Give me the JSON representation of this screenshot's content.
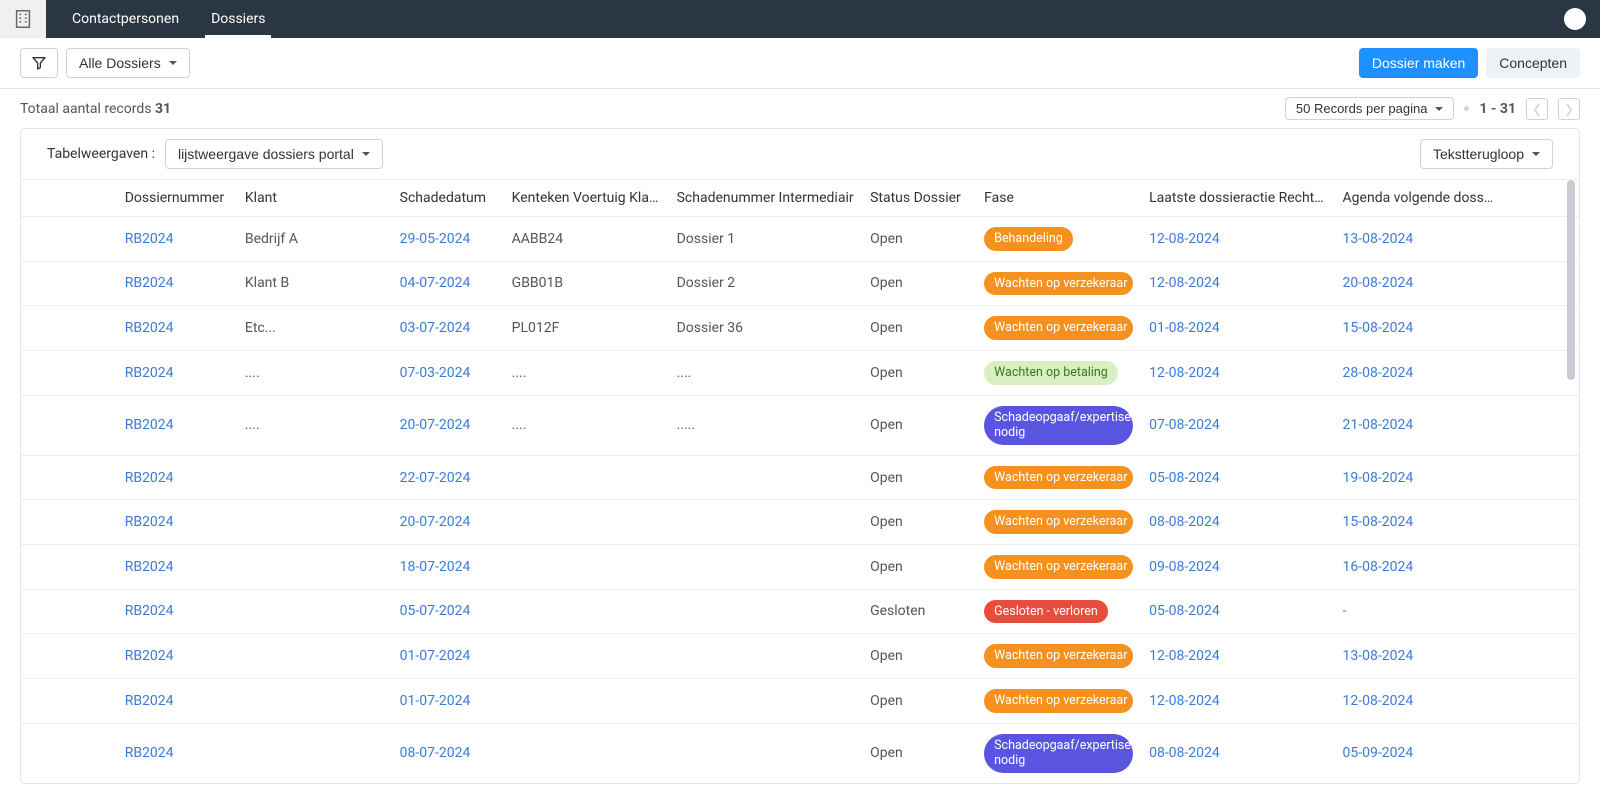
{
  "nav": {
    "items": [
      {
        "label": "Contactpersonen",
        "active": false
      },
      {
        "label": "Dossiers",
        "active": true
      }
    ]
  },
  "toolbar": {
    "view_label": "Alle Dossiers",
    "create_label": "Dossier maken",
    "drafts_label": "Concepten"
  },
  "records": {
    "total_label_prefix": "Totaal aantal records",
    "total_count": "31",
    "per_page_label": "50 Records per pagina",
    "range": "1 - 31"
  },
  "table_toolbar": {
    "label": "Tabelweergaven :",
    "view": "lijstweergave dossiers portal",
    "wrap_label": "Tekstterugloop"
  },
  "columns": [
    "Dossiernummer",
    "Klant",
    "Schadedatum",
    "Kenteken Voertuig Klant",
    "Schadenummer Intermediair",
    "Status Dossier",
    "Fase",
    "Laatste dossieractie RechtBij",
    "Agenda volgende doss…"
  ],
  "phase_colors": {
    "Behandeling": "orange",
    "Wachten op verzekeraar": "orange",
    "Wachten op betaling": "green",
    "Schadeopgaaf/expertiserapport nodig": "purple",
    "Gesloten - verloren": "red"
  },
  "rows": [
    {
      "dossier": "RB2024",
      "klant": "Bedrijf A",
      "schadedatum": "29-05-2024",
      "kenteken": "AABB24",
      "schadenummer": "Dossier 1",
      "status": "Open",
      "fase": "Behandeling",
      "laatste": "12-08-2024",
      "agenda": "13-08-2024"
    },
    {
      "dossier": "RB2024",
      "klant": "Klant B",
      "schadedatum": "04-07-2024",
      "kenteken": "GBB01B",
      "schadenummer": "Dossier 2",
      "status": "Open",
      "fase": "Wachten op verzekeraar",
      "laatste": "12-08-2024",
      "agenda": "20-08-2024"
    },
    {
      "dossier": "RB2024",
      "klant": "Etc...",
      "schadedatum": "03-07-2024",
      "kenteken": "PL012F",
      "schadenummer": "Dossier 36",
      "status": "Open",
      "fase": "Wachten op verzekeraar",
      "laatste": "01-08-2024",
      "agenda": "15-08-2024"
    },
    {
      "dossier": "RB2024",
      "klant": "....",
      "schadedatum": "07-03-2024",
      "kenteken": "....",
      "schadenummer": "....",
      "status": "Open",
      "fase": "Wachten op betaling",
      "laatste": "12-08-2024",
      "agenda": "28-08-2024"
    },
    {
      "dossier": "RB2024",
      "klant": "....",
      "schadedatum": "20-07-2024",
      "kenteken": "....",
      "schadenummer": ".....",
      "status": "Open",
      "fase": "Schadeopgaaf/expertiserapport nodig",
      "laatste": "07-08-2024",
      "agenda": "21-08-2024"
    },
    {
      "dossier": "RB2024",
      "klant": "",
      "schadedatum": "22-07-2024",
      "kenteken": "",
      "schadenummer": "",
      "status": "Open",
      "fase": "Wachten op verzekeraar",
      "laatste": "05-08-2024",
      "agenda": "19-08-2024"
    },
    {
      "dossier": "RB2024",
      "klant": "",
      "schadedatum": "20-07-2024",
      "kenteken": "",
      "schadenummer": "",
      "status": "Open",
      "fase": "Wachten op verzekeraar",
      "laatste": "08-08-2024",
      "agenda": "15-08-2024"
    },
    {
      "dossier": "RB2024",
      "klant": "",
      "schadedatum": "18-07-2024",
      "kenteken": "",
      "schadenummer": "",
      "status": "Open",
      "fase": "Wachten op verzekeraar",
      "laatste": "09-08-2024",
      "agenda": "16-08-2024"
    },
    {
      "dossier": "RB2024",
      "klant": "",
      "schadedatum": "05-07-2024",
      "kenteken": "",
      "schadenummer": "",
      "status": "Gesloten",
      "fase": "Gesloten - verloren",
      "laatste": "05-08-2024",
      "agenda": "-"
    },
    {
      "dossier": "RB2024",
      "klant": "",
      "schadedatum": "01-07-2024",
      "kenteken": "",
      "schadenummer": "",
      "status": "Open",
      "fase": "Wachten op verzekeraar",
      "laatste": "12-08-2024",
      "agenda": "13-08-2024"
    },
    {
      "dossier": "RB2024",
      "klant": "",
      "schadedatum": "01-07-2024",
      "kenteken": "",
      "schadenummer": "",
      "status": "Open",
      "fase": "Wachten op verzekeraar",
      "laatste": "12-08-2024",
      "agenda": "12-08-2024"
    },
    {
      "dossier": "RB2024",
      "klant": "",
      "schadedatum": "08-07-2024",
      "kenteken": "",
      "schadenummer": "",
      "status": "Open",
      "fase": "Schadeopgaaf/expertiserapport nodig",
      "laatste": "08-08-2024",
      "agenda": "05-09-2024"
    }
  ]
}
